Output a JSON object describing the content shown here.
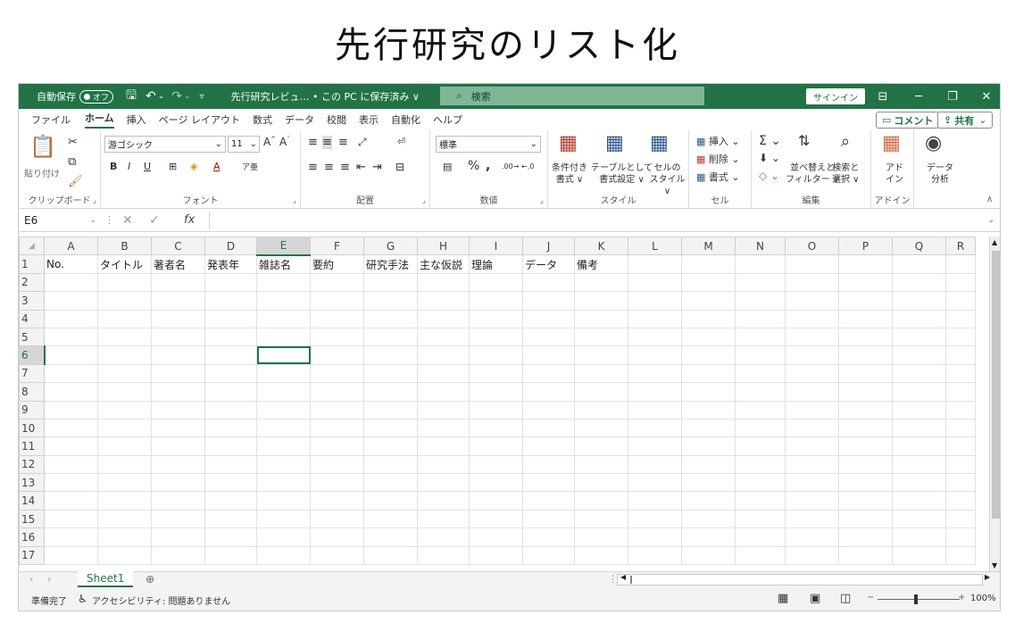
{
  "heading": "先行研究のリスト化",
  "titlebar": {
    "autosave_label": "自動保存",
    "autosave_state": "オフ",
    "doc_title": "先行研究レビュ… • この PC に保存済み ∨",
    "search_placeholder": "検索",
    "signin": "サインイン"
  },
  "menu": {
    "tabs": [
      "ファイル",
      "ホーム",
      "挿入",
      "ページ レイアウト",
      "数式",
      "データ",
      "校閲",
      "表示",
      "自動化",
      "ヘルプ"
    ],
    "comment": "コメント",
    "share": "共有"
  },
  "ribbon": {
    "clipboard": {
      "paste": "貼り付け",
      "label": "クリップボード"
    },
    "font": {
      "name": "游ゴシック",
      "size": "11",
      "label": "フォント"
    },
    "alignment": {
      "label": "配置"
    },
    "number": {
      "format": "標準",
      "label": "数値"
    },
    "styles": {
      "conditional": "条件付き\n書式 ∨",
      "table": "テーブルとして\n書式設定 ∨",
      "cell": "セルの\nスタイル ∨",
      "label": "スタイル"
    },
    "cells": {
      "insert": "挿入",
      "delete": "削除",
      "format": "書式",
      "label": "セル"
    },
    "editing": {
      "sort": "並べ替えと\nフィルター ∨",
      "find": "検索と\n選択 ∨",
      "label": "編集"
    },
    "addins": {
      "addin": "アド\nイン",
      "label": "アドイン"
    },
    "analysis": {
      "analyze": "データ\n分析"
    }
  },
  "formula_bar": {
    "name_box": "E6",
    "fx": "fx",
    "value": ""
  },
  "grid": {
    "columns": [
      "A",
      "B",
      "C",
      "D",
      "E",
      "F",
      "G",
      "H",
      "I",
      "J",
      "K",
      "L",
      "M",
      "N",
      "O",
      "P",
      "Q",
      "R"
    ],
    "rows": [
      "1",
      "2",
      "3",
      "4",
      "5",
      "6",
      "7",
      "8",
      "9",
      "10",
      "11",
      "12",
      "13",
      "14",
      "15",
      "16",
      "17"
    ],
    "row1": [
      "No.",
      "タイトル",
      "著者名",
      "発表年",
      "雑誌名",
      "要約",
      "研究手法",
      "主な仮説",
      "理論",
      "データ",
      "備考"
    ],
    "active_cell": "E6"
  },
  "sheets": [
    "Sheet1"
  ],
  "status": {
    "ready": "準備完了",
    "accessibility": "アクセシビリティ: 問題ありません",
    "zoom": "100%"
  }
}
